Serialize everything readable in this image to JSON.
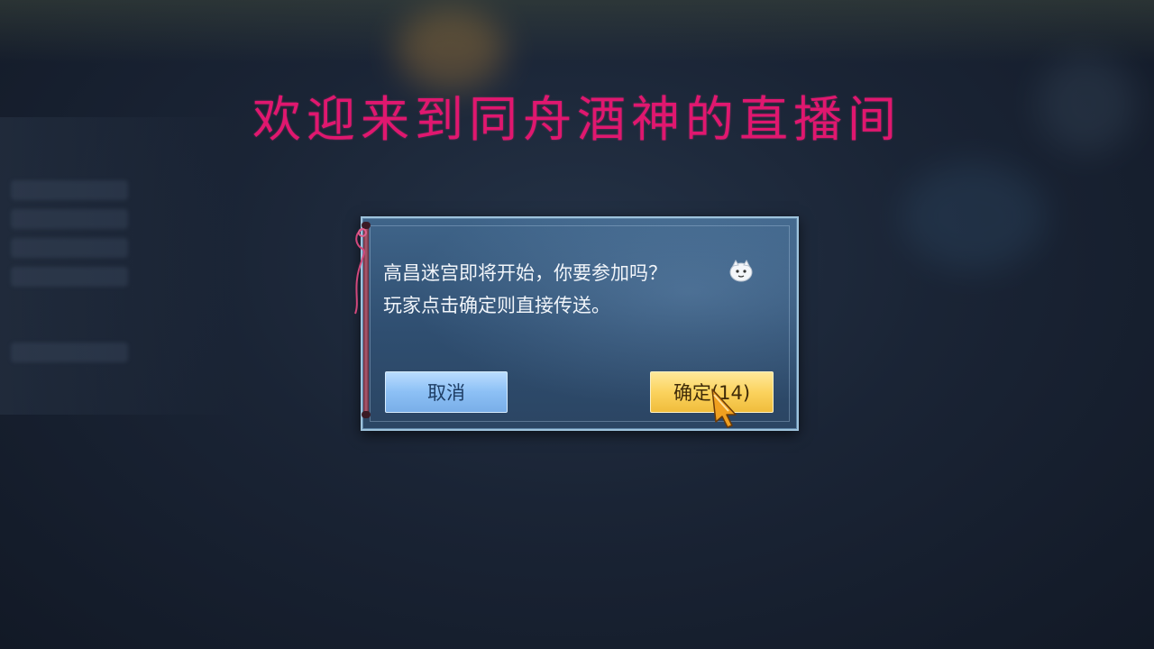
{
  "banner": {
    "text": "欢迎来到同舟酒神的直播间",
    "color": "#e0176f"
  },
  "dialog": {
    "line1": "高昌迷宫即将开始，你要参加吗？",
    "line2": "玩家点击确定则直接传送。",
    "emoji_icon": "snowman-face-icon",
    "cancel_label": "取消",
    "confirm_label": "确定(14)"
  },
  "colors": {
    "dialog_bg": "#2f4e70",
    "cancel_button": "#8cc0f5",
    "confirm_button": "#fbd35e"
  }
}
